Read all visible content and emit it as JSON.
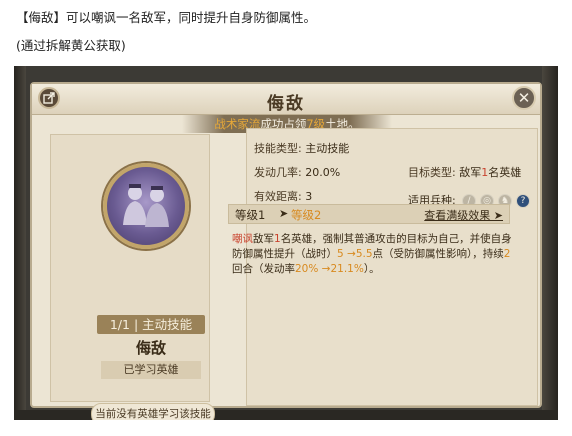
{
  "intro": {
    "line1": "【侮敌】可以嘲讽一名敌军，同时提升自身防御属性。",
    "line2": "(通过拆解黄公获取)"
  },
  "window": {
    "title": "侮敌",
    "share_icon": "share-icon",
    "close_icon": "close-icon",
    "close_glyph": "✕"
  },
  "toast": {
    "name": "战术家流",
    "mid": "成功占领",
    "level": "7级",
    "suffix": "土地。"
  },
  "skill": {
    "level_tag": "1/1 | 主动技能",
    "name": "侮敌",
    "learned_label": "已学习英雄",
    "no_hero_label": "当前没有英雄学习该技能"
  },
  "stats": {
    "type_label": "技能类型:",
    "type_value": "主动技能",
    "rate_label": "发动几率:",
    "rate_value": "20.0%",
    "target_label": "目标类型:",
    "target_pre": "敌军",
    "target_num": "1",
    "target_post": "名英雄",
    "range_label": "有效距离:",
    "range_value": "3",
    "troop_label": "适用兵种:"
  },
  "troops": [
    {
      "name": "sword-troop-icon",
      "glyph": "/"
    },
    {
      "name": "shield-troop-icon",
      "glyph": "◎"
    },
    {
      "name": "horse-troop-icon",
      "glyph": "♞"
    },
    {
      "name": "question-troop-icon",
      "glyph": "?"
    }
  ],
  "levels": {
    "from": "等级1",
    "arrow": "➤",
    "to": "等级2",
    "max_label": "查看满级效果 ➤"
  },
  "description": {
    "p1": "嘲讽",
    "p2": "敌军",
    "p3": "1",
    "p4": "名英雄，强制其普通攻击的目标为自己，并使自身防御属性提升（战时）",
    "p5": "5 →5.5",
    "p6": "点（受防御属性影响），持续",
    "p7": "2",
    "p8": "回合（发动率",
    "p9": "20% →21.1%",
    "p10": "）。"
  },
  "colors": {
    "accent_red": "#c9432e",
    "accent_orange": "#d88a20",
    "panel_bg": "#ece5d4",
    "title_brown": "#4a3a24"
  }
}
